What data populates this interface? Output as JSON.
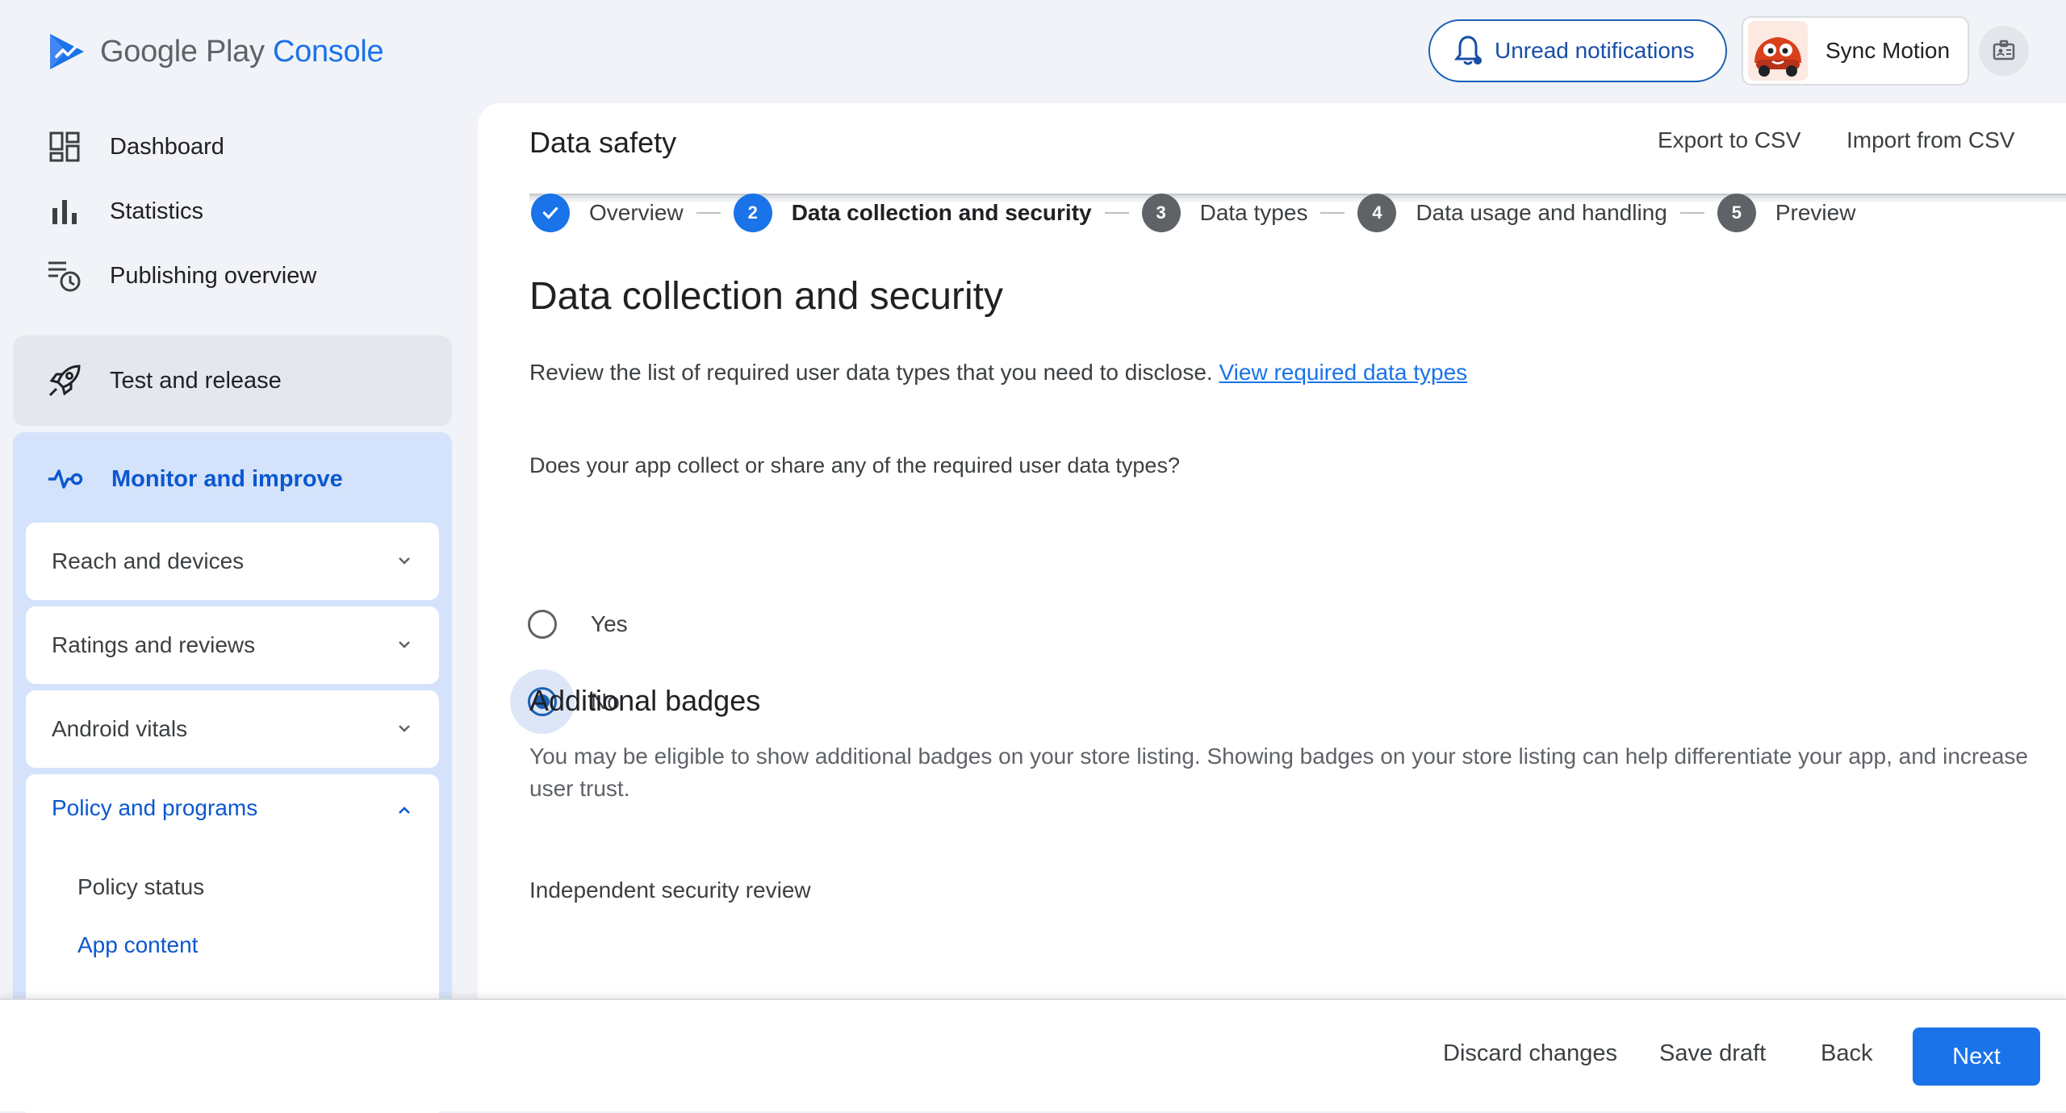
{
  "brand": {
    "name": "Google Play",
    "product": "Console"
  },
  "topbar": {
    "notifications_label": "Unread notifications",
    "account_name": "Sync Motion"
  },
  "sidebar": {
    "items": [
      {
        "label": "Dashboard",
        "icon": "dashboard-icon"
      },
      {
        "label": "Statistics",
        "icon": "bar-chart-icon"
      },
      {
        "label": "Publishing overview",
        "icon": "publishing-clock-icon"
      }
    ],
    "test_release": {
      "label": "Test and release",
      "icon": "rocket-icon"
    },
    "monitor": {
      "label": "Monitor and improve",
      "icon": "pulse-icon",
      "sections": [
        {
          "label": "Reach and devices"
        },
        {
          "label": "Ratings and reviews"
        },
        {
          "label": "Android vitals"
        }
      ],
      "policy": {
        "label": "Policy and programs",
        "items": [
          {
            "label": "Policy status",
            "active": false
          },
          {
            "label": "App content",
            "active": true
          }
        ]
      }
    }
  },
  "page": {
    "title": "Data safety",
    "export_label": "Export to CSV",
    "import_label": "Import from CSV"
  },
  "stepper": [
    {
      "number": "✓",
      "label": "Overview",
      "state": "done"
    },
    {
      "number": "2",
      "label": "Data collection and security",
      "state": "active"
    },
    {
      "number": "3",
      "label": "Data types",
      "state": "todo"
    },
    {
      "number": "4",
      "label": "Data usage and handling",
      "state": "todo"
    },
    {
      "number": "5",
      "label": "Preview",
      "state": "todo"
    }
  ],
  "content": {
    "heading": "Data collection and security",
    "intro": "Review the list of required user data types that you need to disclose.",
    "intro_link": "View required data types",
    "question": "Does your app collect or share any of the required user data types?",
    "options": [
      {
        "label": "Yes",
        "selected": false
      },
      {
        "label": "No",
        "selected": true
      }
    ],
    "badges_heading": "Additional badges",
    "badges_desc": "You may be eligible to show additional badges on your store listing. Showing badges on your store listing can help differentiate your app, and increase user trust.",
    "security_review": "Independent security review"
  },
  "footer": {
    "discard": "Discard changes",
    "save": "Save draft",
    "back": "Back",
    "next": "Next"
  },
  "colors": {
    "accent": "#1a73e8",
    "active_nav_bg": "#d4e3fb",
    "step_todo": "#5f6368"
  }
}
